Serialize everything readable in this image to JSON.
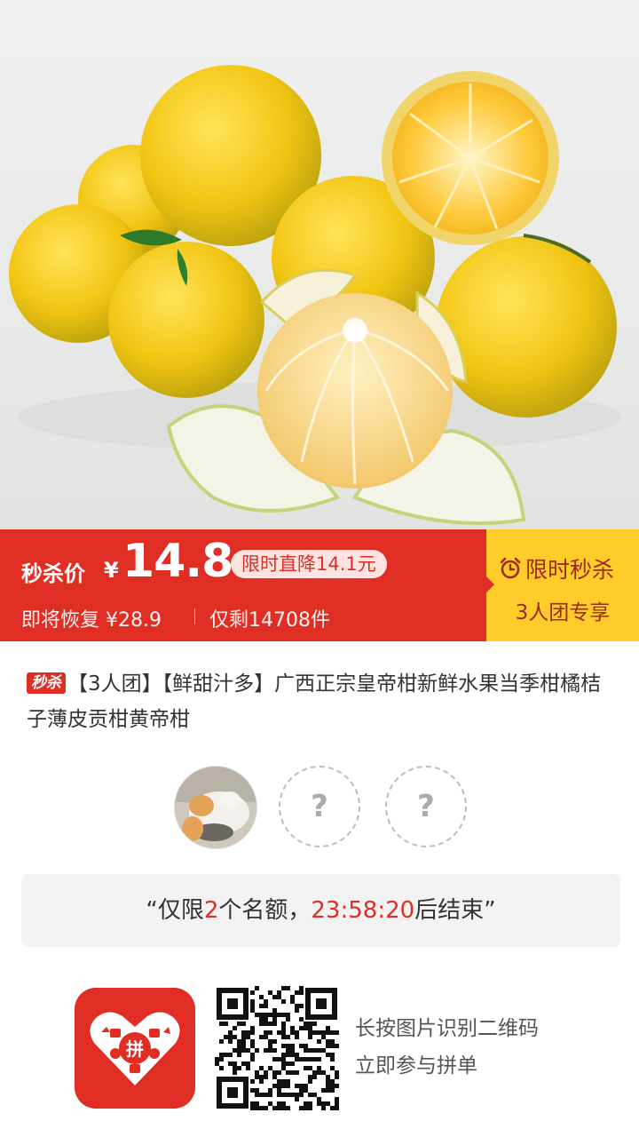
{
  "hero": {
    "image_desc_icon": "orange-fruit-photo"
  },
  "price": {
    "label": "秒杀价",
    "symbol": "¥",
    "value": "14.8",
    "discount": "限时直降14.1元",
    "restore": "即将恢复 ¥28.9",
    "stock": "仅剩14708件"
  },
  "flash_sale": {
    "icon": "alarm-clock-icon",
    "title": "限时秒杀",
    "group": "3人团专享"
  },
  "product": {
    "tag": "秒杀",
    "title": "【3人团】【鲜甜汁多】广西正宗皇帝柑新鲜水果当季柑橘桔子薄皮贡柑黄帝柑"
  },
  "group_slots": {
    "placeholder": "?"
  },
  "quota": {
    "prefix": "“仅限",
    "count": "2",
    "middle": "个名额，",
    "time": "23:58:20",
    "suffix": "后结束”"
  },
  "footer": {
    "line1": "长按图片识别二维码",
    "line2": "立即参与拼单"
  },
  "colors": {
    "brand_red": "#e02e24",
    "flash_yellow": "#ffcc2a",
    "flash_text": "#9e2a1c"
  }
}
